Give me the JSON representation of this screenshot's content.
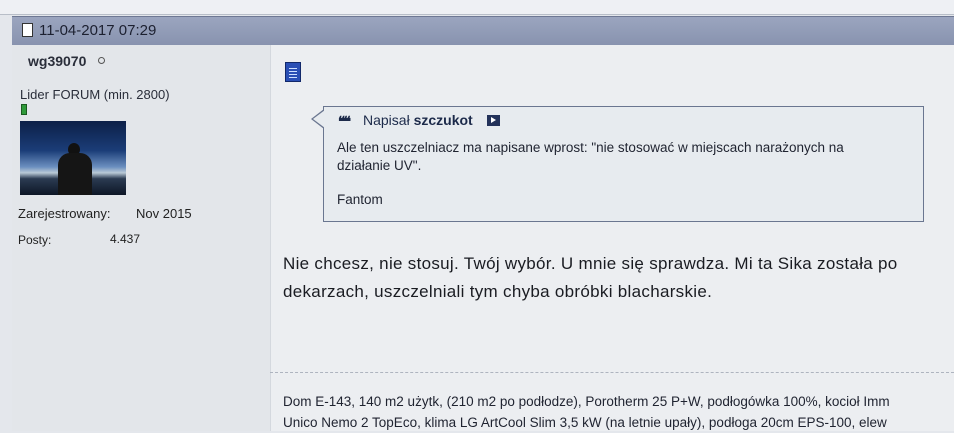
{
  "post": {
    "date": "11-04-2017 07:29",
    "user": {
      "name": "wg39070",
      "rank": "Lider FORUM (min. 2800)",
      "registered_label": "Zarejestrowany:",
      "registered_value": "Nov 2015",
      "posts_label": "Posty:",
      "posts_value": "4.437"
    },
    "quote": {
      "header_prefix": "Napisał",
      "author": "szczukot",
      "text": "Ale ten uszczelniacz ma napisane wprost: \"nie stosować w miejscach narażonych na działanie UV\".",
      "signature": "Fantom"
    },
    "body": "Nie chcesz, nie stosuj. Twój wybór. U mnie się sprawdza. Mi ta Sika została po dekarzach, uszczelniali tym chyba obróbki blacharskie.",
    "signature_lines": [
      "Dom E-143, 140 m2 użytk, (210 m2 po podłodze), Porotherm 25 P+W, podłogówka 100%, kocioł Imm",
      "Unico Nemo 2 TopEco, klima LG ArtCool Slim 3,5 kW (na letnie upały), podłoga 20cm EPS-100, elew"
    ]
  },
  "icons": {
    "post_header": "document-icon",
    "online_status": "offline-status-icon",
    "reputation": "reputation-bar-icon",
    "post": "post-icon",
    "quote": "quote-icon",
    "view_post": "view-post-icon"
  },
  "colors": {
    "header_bar": "#8f99b3",
    "quote_border": "#6a7690",
    "post_icon": "#2a4fb5",
    "reputation": "#2f9a3a"
  }
}
